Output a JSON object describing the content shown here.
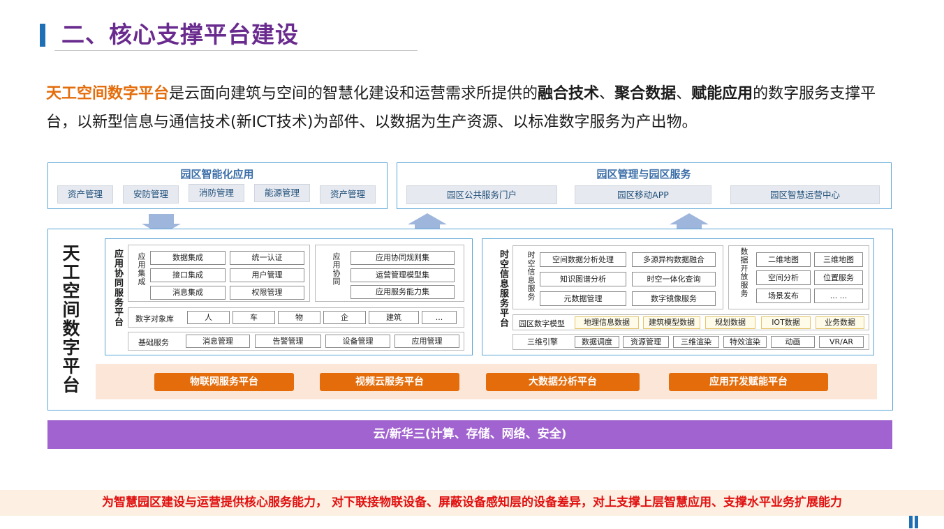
{
  "header": {
    "title": "二、核心支撑平台建设"
  },
  "intro": {
    "part1": "天工空间数字平台",
    "part2": "是云面向建筑与空间的智慧化建设和运营需求所提供的",
    "kw1": "融合技术",
    "sep1": "、",
    "kw2": "聚合数据",
    "sep2": "、",
    "kw3": "赋能应用",
    "part3": "的数字服务支撑平台，以新型信息与通信技术(新ICT技术)为部件、以数据为生产资源、以标准数字服务为产出物。"
  },
  "top_left": {
    "title": "园区智能化应用",
    "items": [
      "资产管理",
      "安防管理",
      "消防管理",
      "能源管理",
      "资产管理"
    ]
  },
  "top_right": {
    "title": "园区管理与园区服务",
    "items": [
      "园区公共服务门户",
      "园区移动APP",
      "园区智慧运营中心"
    ]
  },
  "platform": {
    "name": "天工空间数字平台",
    "app_collab": {
      "label": "应用协同服务平台",
      "integration_label": "应用集成",
      "integration_items": [
        "数据集成",
        "统一认证",
        "接口集成",
        "用户管理",
        "消息集成",
        "权限管理"
      ],
      "collab_label": "应用协同",
      "collab_items": [
        "应用协同规则集",
        "运营管理模型集",
        "应用服务能力集"
      ],
      "object_label": "数字对象库",
      "object_items": [
        "人",
        "车",
        "物",
        "企",
        "建筑",
        "..."
      ],
      "base_label": "基础服务",
      "base_items": [
        "消息管理",
        "告警管理",
        "设备管理",
        "应用管理"
      ]
    },
    "spatial": {
      "label": "时空信息服务平台",
      "info_label": "时空信息服务",
      "info_items": [
        "空间数据分析处理",
        "多源异构数据融合",
        "知识图谱分析",
        "时空一体化查询",
        "元数据管理",
        "数字镜像服务"
      ],
      "open_label": "数据开放服务",
      "open_items": [
        "二维地图",
        "三维地图",
        "空间分析",
        "位置服务",
        "场景发布",
        "... ..."
      ],
      "model_label": "园区数字模型",
      "model_items": [
        "地理信息数据",
        "建筑模型数据",
        "规划数据",
        "IOT数据",
        "业务数据"
      ],
      "engine_items": [
        "三维引擎",
        "数据调度",
        "资源管理",
        "三维渲染",
        "特效渲染",
        "动画",
        "VR/AR"
      ]
    },
    "bottom_items": [
      "物联网服务平台",
      "视频云服务平台",
      "大数据分析平台",
      "应用开发赋能平台"
    ]
  },
  "cloud": {
    "label": "云/新华三(计算、存储、网络、安全)"
  },
  "footer": {
    "text": "为智慧园区建设与运营提供核心服务能力，  对下联接物联设备、屏蔽设备感知层的设备差异，对上支撑上层智慧应用、支撑水平业务扩展能力"
  },
  "colors": {
    "accent_orange": "#e46c0a",
    "title_purple": "#6a2b8f",
    "cloud_purple": "#a163cf",
    "border_blue": "#5aa5d6",
    "footer_red": "#e01010"
  }
}
